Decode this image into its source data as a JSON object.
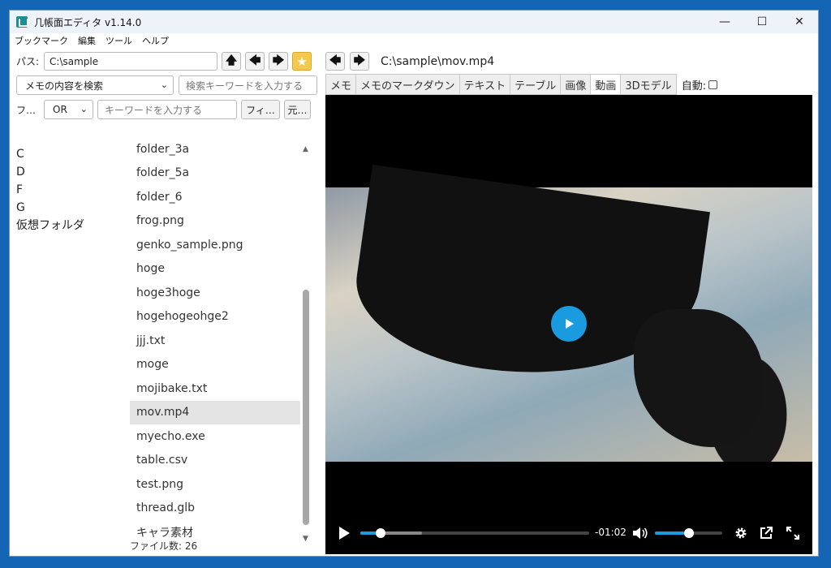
{
  "window": {
    "title": "几帳面エディタ v1.14.0",
    "app_icon": "app-icon",
    "minimize": "—",
    "maximize": "☐",
    "close": "✕"
  },
  "menu": [
    "ブックマーク",
    "編集",
    "ツール",
    "ヘルプ"
  ],
  "left": {
    "path_label": "パス:",
    "path_value": "C:\\sample",
    "up_icon": "🡅",
    "back_icon": "🡄",
    "forward_icon": "🡆",
    "bookmark_icon": "★",
    "search_mode": "メモの内容を検索",
    "search_placeholder": "検索キーワードを入力する",
    "filter_label": "フ…",
    "filter_op": "OR",
    "keyword_placeholder": "キーワードを入力する",
    "filter_button": "フィ…",
    "restore_button": "元…",
    "drives": [
      "C",
      "D",
      "F",
      "G",
      "仮想フォルダ"
    ],
    "files": [
      {
        "name": "folder_3a"
      },
      {
        "name": "folder_5a"
      },
      {
        "name": "folder_6"
      },
      {
        "name": "frog.png"
      },
      {
        "name": "genko_sample.png"
      },
      {
        "name": "hoge"
      },
      {
        "name": "hoge3hoge"
      },
      {
        "name": "hogehogeohge2"
      },
      {
        "name": "jjj.txt"
      },
      {
        "name": "moge"
      },
      {
        "name": "mojibake.txt"
      },
      {
        "name": "mov.mp4",
        "selected": true
      },
      {
        "name": "myecho.exe"
      },
      {
        "name": "table.csv"
      },
      {
        "name": "test.png"
      },
      {
        "name": "thread.glb"
      },
      {
        "name": "キャラ素材"
      }
    ],
    "file_count": "ファイル数: 26"
  },
  "right": {
    "back_icon": "🡄",
    "forward_icon": "🡆",
    "file_path": "C:\\sample\\mov.mp4",
    "tabs": [
      "メモ",
      "メモのマークダウン",
      "テキスト",
      "テーブル",
      "画像",
      "動画",
      "3Dモデル"
    ],
    "active_tab": "動画",
    "auto_label": "自動:",
    "video": {
      "time_remaining": "-01:02",
      "progress": 0.09,
      "buffered": 0.27,
      "volume": 0.5
    }
  },
  "colors": {
    "accent": "#1a9be0",
    "star": "#f4c84a",
    "desktop": "#1565b5"
  }
}
